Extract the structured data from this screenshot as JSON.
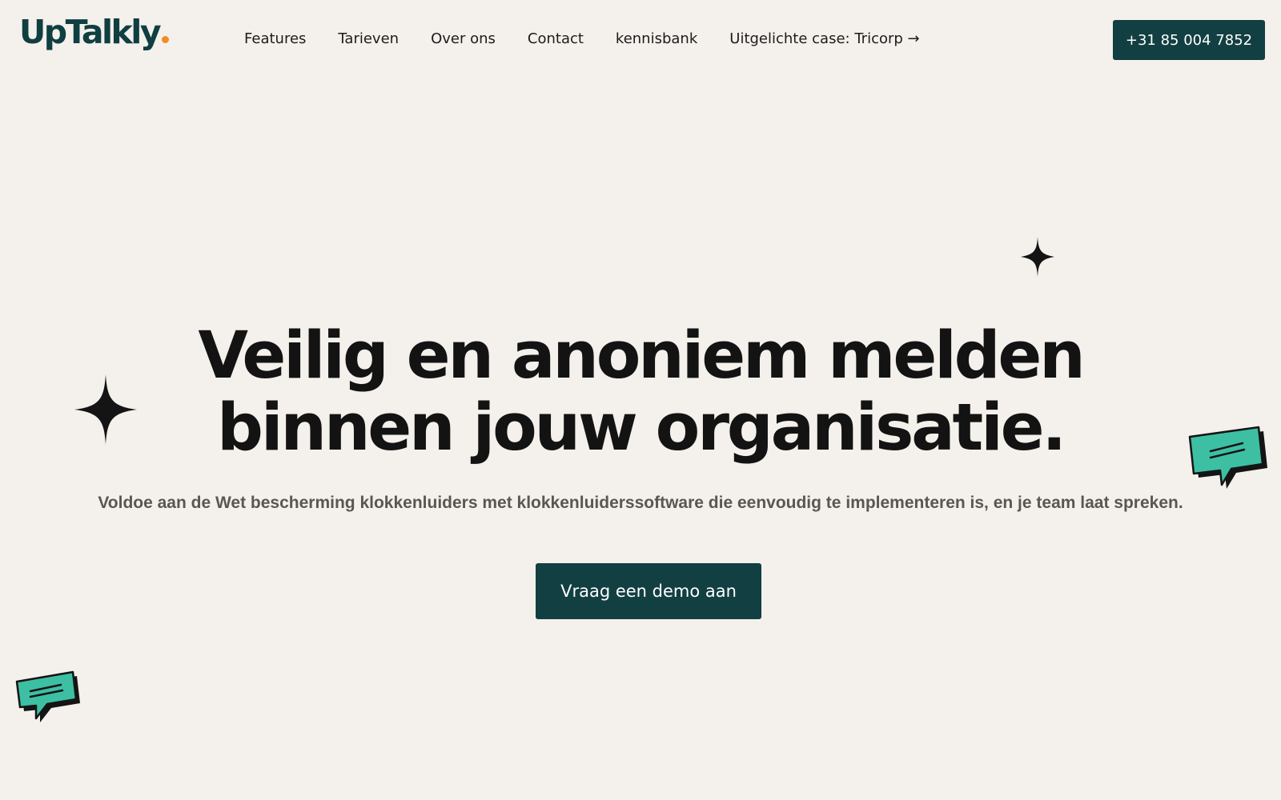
{
  "brand": {
    "name": "UpTalkly",
    "colors": {
      "primary": "#123f42",
      "accent": "#f28c28",
      "bubble": "#3dbfa3",
      "background": "#f4f0eb"
    }
  },
  "nav": {
    "items": [
      {
        "label": "Features"
      },
      {
        "label": "Tarieven"
      },
      {
        "label": "Over ons"
      },
      {
        "label": "Contact"
      },
      {
        "label": "kennisbank"
      },
      {
        "label": "Uitgelichte case: Tricorp →"
      }
    ]
  },
  "header": {
    "phone_label": "+31 85 004 7852"
  },
  "hero": {
    "headline_line1": "Veilig en anoniem melden",
    "headline_line2": "binnen jouw organisatie.",
    "subtext": "Voldoe aan de Wet bescherming klokkenluiders met klokkenluiderssoftware die eenvoudig te implementeren is, en je team laat spreken.",
    "cta_label": "Vraag een demo aan"
  },
  "decorations": {
    "icons": [
      "sparkle-icon",
      "sparkle-icon",
      "speech-bubble-icon",
      "speech-bubble-icon"
    ]
  }
}
